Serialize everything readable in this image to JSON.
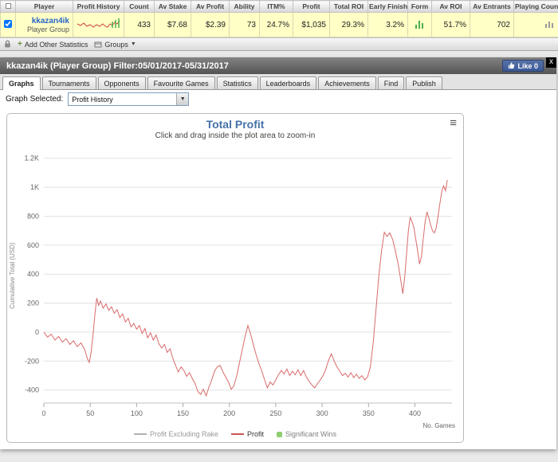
{
  "stats_table": {
    "columns": [
      "Player",
      "Profit History",
      "Count",
      "Av Stake",
      "Av Profit",
      "Ability",
      "ITM%",
      "Profit",
      "Total ROI",
      "Early Finish",
      "Form",
      "Av ROI",
      "Av Entrants",
      "Playing Count"
    ],
    "row": {
      "player_name": "kkazan4ik",
      "player_type": "Player Group",
      "count": "433",
      "av_stake": "$7.68",
      "av_profit": "$2.39",
      "ability": "73",
      "itm": "24.7%",
      "profit": "$1,035",
      "total_roi": "29.3%",
      "early_finish": "3.2%",
      "av_roi": "51.7%",
      "av_entrants": "702"
    }
  },
  "toolbar": {
    "add_other_statistics": "Add Other Statistics",
    "groups": "Groups"
  },
  "panel": {
    "title": "kkazan4ik (Player Group) Filter:05/01/2017-05/31/2017",
    "like_label": "Like 0",
    "tabs": [
      "Graphs",
      "Tournaments",
      "Opponents",
      "Favourite Games",
      "Statistics",
      "Leaderboards",
      "Achievements",
      "Find",
      "Publish"
    ],
    "active_tab": "Graphs",
    "graph_selected_label": "Graph Selected:",
    "graph_selected_value": "Profit History"
  },
  "icons": {
    "hamburger": "≡",
    "close": "x",
    "select_arrow": "▼",
    "plus": "+",
    "dropdown_arrow": "▼"
  },
  "chart_data": {
    "type": "line",
    "title": "Total Profit",
    "subtitle": "Click and drag inside the plot area to zoom-in",
    "xlabel": "No. Games",
    "ylabel": "Cumulative Total (USD)",
    "xlim": [
      0,
      440
    ],
    "ylim": [
      -490,
      1270
    ],
    "yticks": [
      -400,
      -200,
      0,
      200,
      400,
      600,
      800,
      1000,
      1200
    ],
    "ytick_labels": [
      "-400",
      "-200",
      "0",
      "200",
      "400",
      "600",
      "800",
      "1K",
      "1.2K"
    ],
    "xticks": [
      0,
      50,
      100,
      150,
      200,
      250,
      300,
      350,
      400
    ],
    "grid": true,
    "legend_position": "bottom",
    "legend": [
      {
        "label": "Profit Excluding Rake",
        "color": "#b0b0b0",
        "text_color": "#999999",
        "marker": "line"
      },
      {
        "label": "Profit",
        "color": "#cc5555",
        "text_color": "#333333",
        "marker": "line"
      },
      {
        "label": "Significant Wins",
        "color": "#8fce6f",
        "text_color": "#808080",
        "marker": "square"
      }
    ],
    "series": [
      {
        "name": "Profit",
        "color": "#d96a6a",
        "points": [
          [
            0,
            0
          ],
          [
            4,
            -35
          ],
          [
            8,
            -15
          ],
          [
            12,
            -55
          ],
          [
            16,
            -30
          ],
          [
            20,
            -70
          ],
          [
            24,
            -45
          ],
          [
            28,
            -85
          ],
          [
            32,
            -60
          ],
          [
            36,
            -100
          ],
          [
            40,
            -75
          ],
          [
            44,
            -120
          ],
          [
            47,
            -185
          ],
          [
            49,
            -210
          ],
          [
            51,
            -140
          ],
          [
            53,
            -20
          ],
          [
            55,
            120
          ],
          [
            57,
            235
          ],
          [
            59,
            185
          ],
          [
            61,
            215
          ],
          [
            64,
            165
          ],
          [
            67,
            195
          ],
          [
            70,
            150
          ],
          [
            73,
            175
          ],
          [
            76,
            130
          ],
          [
            79,
            155
          ],
          [
            82,
            100
          ],
          [
            85,
            125
          ],
          [
            88,
            70
          ],
          [
            91,
            95
          ],
          [
            94,
            35
          ],
          [
            97,
            60
          ],
          [
            100,
            20
          ],
          [
            103,
            45
          ],
          [
            106,
            -10
          ],
          [
            109,
            25
          ],
          [
            112,
            -40
          ],
          [
            115,
            -5
          ],
          [
            118,
            -55
          ],
          [
            121,
            -20
          ],
          [
            124,
            -80
          ],
          [
            127,
            -110
          ],
          [
            130,
            -85
          ],
          [
            133,
            -140
          ],
          [
            136,
            -115
          ],
          [
            139,
            -180
          ],
          [
            142,
            -230
          ],
          [
            145,
            -275
          ],
          [
            148,
            -240
          ],
          [
            151,
            -265
          ],
          [
            154,
            -305
          ],
          [
            157,
            -280
          ],
          [
            160,
            -320
          ],
          [
            163,
            -355
          ],
          [
            166,
            -410
          ],
          [
            169,
            -430
          ],
          [
            172,
            -395
          ],
          [
            175,
            -440
          ],
          [
            178,
            -380
          ],
          [
            181,
            -330
          ],
          [
            184,
            -270
          ],
          [
            187,
            -240
          ],
          [
            190,
            -230
          ],
          [
            193,
            -275
          ],
          [
            196,
            -310
          ],
          [
            199,
            -345
          ],
          [
            202,
            -395
          ],
          [
            205,
            -370
          ],
          [
            208,
            -300
          ],
          [
            211,
            -210
          ],
          [
            214,
            -120
          ],
          [
            217,
            -30
          ],
          [
            220,
            45
          ],
          [
            223,
            -15
          ],
          [
            226,
            -90
          ],
          [
            229,
            -160
          ],
          [
            232,
            -220
          ],
          [
            235,
            -270
          ],
          [
            238,
            -330
          ],
          [
            241,
            -385
          ],
          [
            244,
            -345
          ],
          [
            247,
            -365
          ],
          [
            250,
            -330
          ],
          [
            253,
            -295
          ],
          [
            256,
            -265
          ],
          [
            259,
            -290
          ],
          [
            262,
            -255
          ],
          [
            265,
            -300
          ],
          [
            268,
            -270
          ],
          [
            271,
            -295
          ],
          [
            274,
            -260
          ],
          [
            277,
            -300
          ],
          [
            280,
            -265
          ],
          [
            283,
            -310
          ],
          [
            286,
            -340
          ],
          [
            289,
            -365
          ],
          [
            292,
            -385
          ],
          [
            295,
            -355
          ],
          [
            298,
            -330
          ],
          [
            301,
            -300
          ],
          [
            304,
            -255
          ],
          [
            307,
            -195
          ],
          [
            310,
            -150
          ],
          [
            313,
            -200
          ],
          [
            316,
            -240
          ],
          [
            319,
            -270
          ],
          [
            322,
            -300
          ],
          [
            325,
            -285
          ],
          [
            328,
            -310
          ],
          [
            331,
            -280
          ],
          [
            334,
            -315
          ],
          [
            337,
            -290
          ],
          [
            340,
            -320
          ],
          [
            343,
            -300
          ],
          [
            346,
            -330
          ],
          [
            349,
            -310
          ],
          [
            352,
            -240
          ],
          [
            355,
            -80
          ],
          [
            358,
            150
          ],
          [
            361,
            380
          ],
          [
            364,
            560
          ],
          [
            367,
            690
          ],
          [
            370,
            660
          ],
          [
            373,
            685
          ],
          [
            376,
            640
          ],
          [
            379,
            560
          ],
          [
            382,
            470
          ],
          [
            385,
            350
          ],
          [
            387,
            265
          ],
          [
            389,
            380
          ],
          [
            391,
            540
          ],
          [
            393,
            700
          ],
          [
            395,
            795
          ],
          [
            397,
            760
          ],
          [
            399,
            720
          ],
          [
            401,
            640
          ],
          [
            403,
            560
          ],
          [
            405,
            470
          ],
          [
            407,
            520
          ],
          [
            409,
            640
          ],
          [
            411,
            760
          ],
          [
            413,
            830
          ],
          [
            415,
            790
          ],
          [
            417,
            740
          ],
          [
            419,
            700
          ],
          [
            421,
            685
          ],
          [
            423,
            720
          ],
          [
            425,
            800
          ],
          [
            427,
            890
          ],
          [
            429,
            970
          ],
          [
            431,
            1010
          ],
          [
            433,
            975
          ],
          [
            435,
            1050
          ]
        ]
      }
    ]
  }
}
